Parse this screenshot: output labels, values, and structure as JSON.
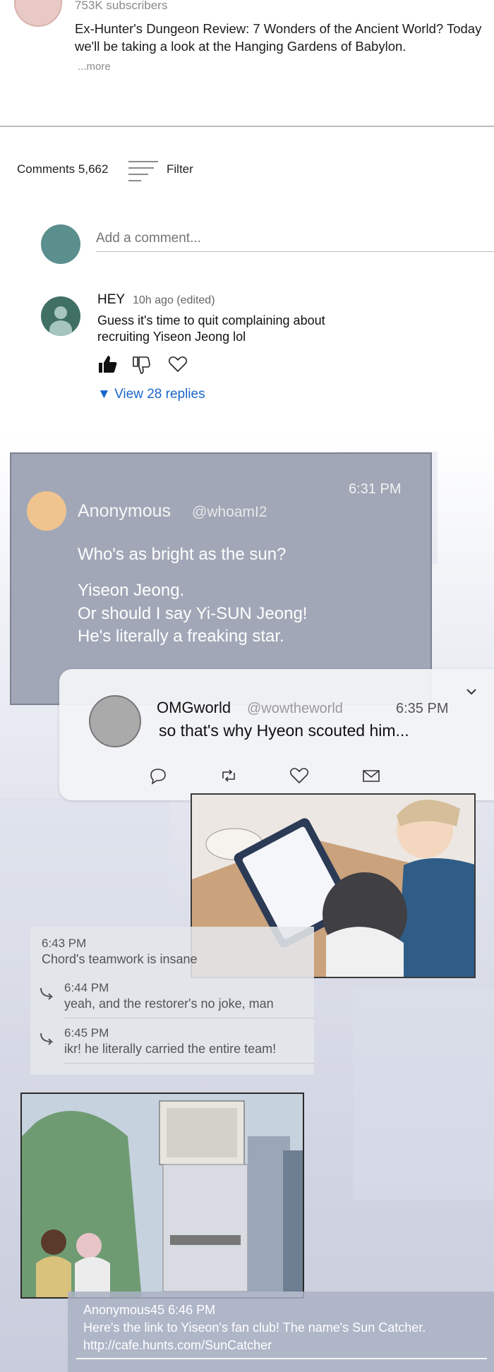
{
  "video": {
    "subscribers": "753K subscribers",
    "description": "Ex-Hunter's Dungeon Review: 7 Wonders of the Ancient World? Today we'll be taking a look at the Hanging Gardens of Babylon.",
    "more_label": "...more"
  },
  "comments": {
    "count_label": "Comments 5,662",
    "filter_label": "Filter",
    "add_placeholder": "Add a comment...",
    "items": [
      {
        "author": "HEY",
        "time": "10h ago (edited)",
        "text_lines": [
          "Guess it's time to quit complaining about",
          "recruiting Yiseon Jeong lol"
        ],
        "view_replies": "▼ View 28 replies"
      }
    ]
  },
  "anon_post": {
    "time": "6:31 PM",
    "name": "Anonymous",
    "handle": "@whoamI2",
    "lines": [
      "Who's as bright as the sun?",
      "Yiseon Jeong.",
      "Or should I say Yi-SUN Jeong!",
      "He's literally a freaking star."
    ]
  },
  "omg_post": {
    "name": "OMGworld",
    "handle": "@wowtheworld",
    "time": "6:35 PM",
    "text": "so that's why Hyeon scouted him..."
  },
  "chat": [
    {
      "time": "6:43 PM",
      "text": "Chord's teamwork is insane"
    },
    {
      "time": "6:44 PM",
      "text": "yeah, and the restorer's no joke, man"
    },
    {
      "time": "6:45 PM",
      "text": "ikr! he literally carried the entire team!"
    }
  ],
  "bottom_post": {
    "header": "Anonymous45  6:46 PM",
    "text": "Here's the link to Yiseon's fan club! The name's Sun Catcher.",
    "link": "http://cafe.hunts.com/SunCatcher"
  },
  "colors": {
    "link_blue": "#1b66c9",
    "anon_card": "#a1a7b7",
    "anon_avatar": "#f0c48f",
    "my_avatar": "#5b8f8e"
  }
}
